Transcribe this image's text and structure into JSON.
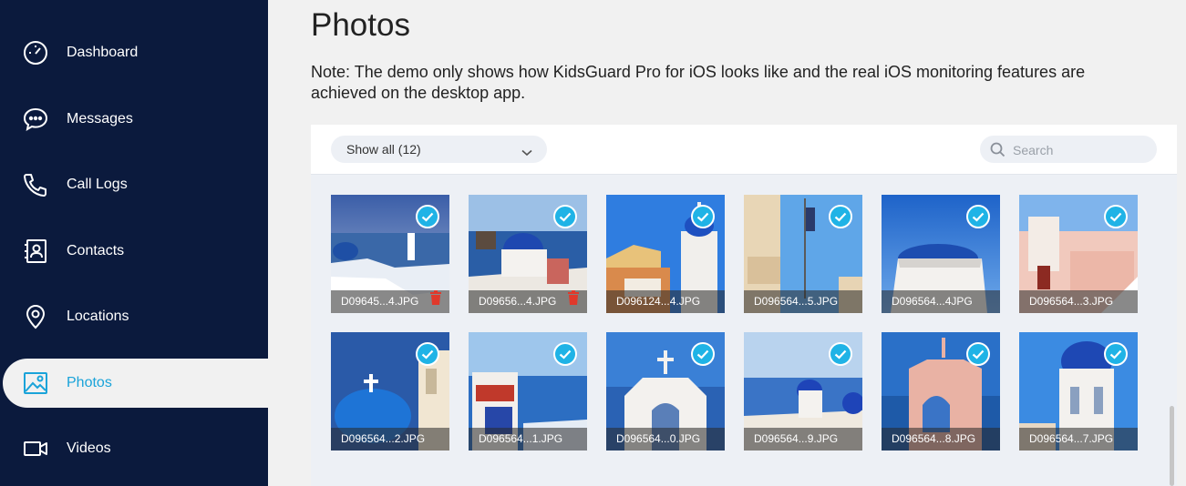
{
  "sidebar": {
    "items": [
      {
        "label": "Dashboard",
        "icon": "gauge-icon",
        "active": false
      },
      {
        "label": "Messages",
        "icon": "chat-bubble-icon",
        "active": false
      },
      {
        "label": "Call Logs",
        "icon": "phone-icon",
        "active": false
      },
      {
        "label": "Contacts",
        "icon": "contact-card-icon",
        "active": false
      },
      {
        "label": "Locations",
        "icon": "map-pin-icon",
        "active": false
      },
      {
        "label": "Photos",
        "icon": "image-icon",
        "active": true
      },
      {
        "label": "Videos",
        "icon": "video-camera-icon",
        "active": false
      }
    ]
  },
  "main": {
    "title": "Photos",
    "note": "Note: The demo only shows how KidsGuard Pro for iOS looks like and the real iOS monitoring features are achieved on the desktop app.",
    "toolbar": {
      "filter_value": "Show all (12)",
      "search_placeholder": "Search"
    },
    "photos": [
      {
        "name": "D09645...4.JPG",
        "deletable": true,
        "checked": true
      },
      {
        "name": "D09656...4.JPG",
        "deletable": true,
        "checked": true
      },
      {
        "name": "D096124...4.JPG",
        "deletable": false,
        "checked": true
      },
      {
        "name": "D096564...5.JPG",
        "deletable": false,
        "checked": true
      },
      {
        "name": "D096564...4JPG",
        "deletable": false,
        "checked": true
      },
      {
        "name": "D096564...3.JPG",
        "deletable": false,
        "checked": true
      },
      {
        "name": "D096564...2.JPG",
        "deletable": false,
        "checked": true
      },
      {
        "name": "D096564...1.JPG",
        "deletable": false,
        "checked": true
      },
      {
        "name": "D096564...0.JPG",
        "deletable": false,
        "checked": true
      },
      {
        "name": "D096564...9.JPG",
        "deletable": false,
        "checked": true
      },
      {
        "name": "D096564...8.JPG",
        "deletable": false,
        "checked": true
      },
      {
        "name": "D096564...7.JPG",
        "deletable": false,
        "checked": true
      }
    ]
  },
  "colors": {
    "sidebar_bg": "#0b1a3d",
    "accent": "#1aa3d9",
    "check": "#1fb3e6",
    "delete": "#e0392b"
  }
}
